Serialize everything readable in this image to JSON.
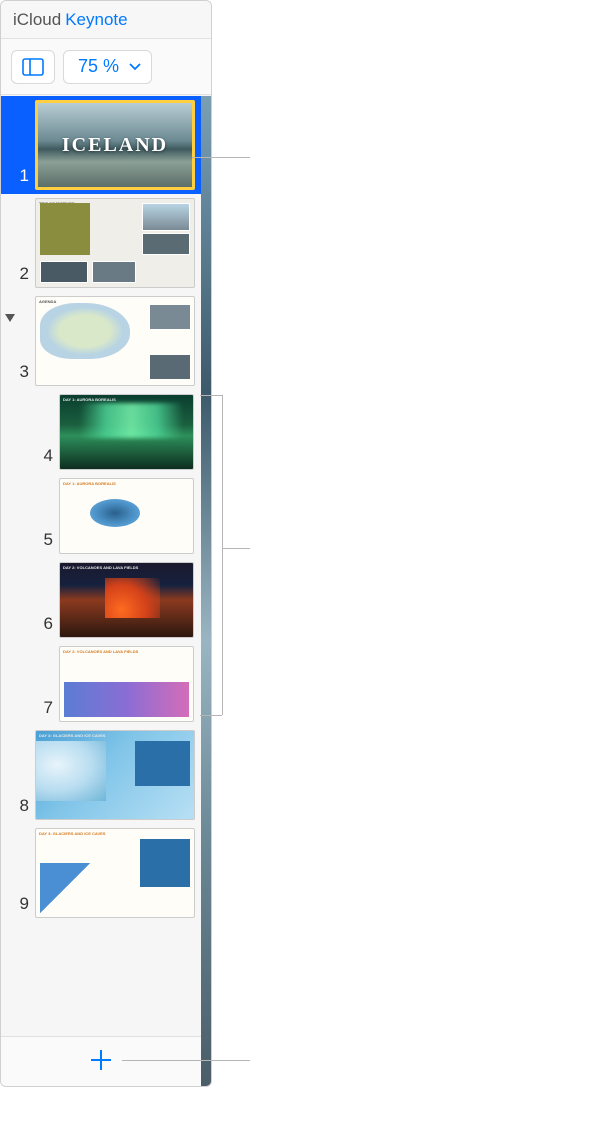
{
  "header": {
    "icloud": "iCloud",
    "app_name": "Keynote"
  },
  "toolbar": {
    "zoom_value": "75 %"
  },
  "slides": [
    {
      "number": "1",
      "selected": true,
      "indented": false,
      "title": "ICELAND",
      "theme": "t1"
    },
    {
      "number": "2",
      "selected": false,
      "indented": false,
      "header": "TRIP OBJECTIVES",
      "theme": "t2"
    },
    {
      "number": "3",
      "selected": false,
      "indented": false,
      "header": "AGENDA",
      "theme": "t3",
      "has_disclosure": true
    },
    {
      "number": "4",
      "selected": false,
      "indented": true,
      "header": "DAY 1: AURORA BOREALIS",
      "theme": "t4"
    },
    {
      "number": "5",
      "selected": false,
      "indented": true,
      "header": "DAY 1: AURORA BOREALIS",
      "theme": "t5"
    },
    {
      "number": "6",
      "selected": false,
      "indented": true,
      "header": "DAY 2: VOLCANOES AND LAVA FIELDS",
      "theme": "t6"
    },
    {
      "number": "7",
      "selected": false,
      "indented": true,
      "header": "DAY 2: VOLCANOES AND LAVA FIELDS",
      "theme": "t7"
    },
    {
      "number": "8",
      "selected": false,
      "indented": false,
      "header": "DAY 3: GLACIERS AND ICE CAVES",
      "theme": "t8"
    },
    {
      "number": "9",
      "selected": false,
      "indented": false,
      "header": "DAY 3: GLACIERS AND ICE CAVES",
      "theme": "t9"
    }
  ],
  "icons": {
    "view": "view-navigator-icon",
    "chevron": "chevron-down-icon",
    "disclosure": "disclosure-down-icon",
    "add": "plus-icon"
  }
}
